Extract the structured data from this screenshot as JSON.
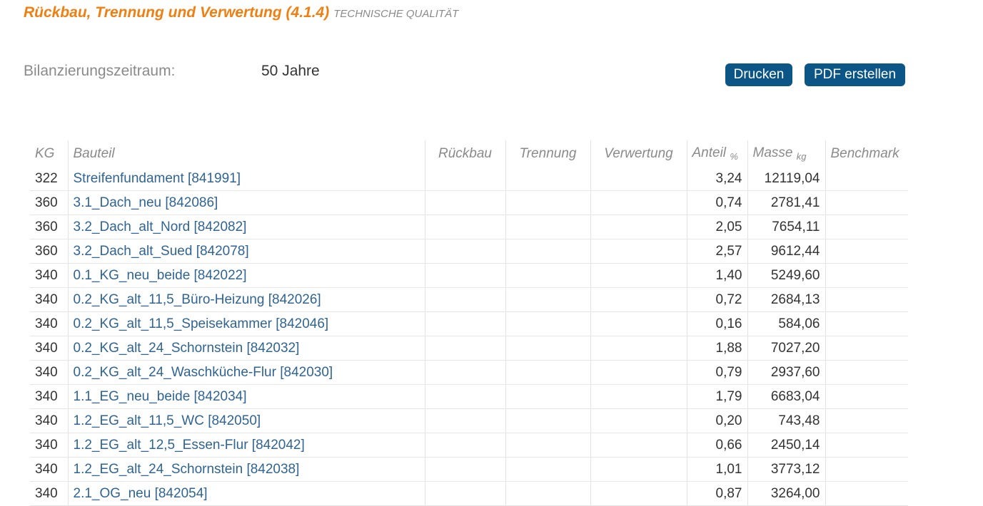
{
  "header": {
    "title": "Rückbau, Trennung und Verwertung (4.1.4)",
    "subtitle": "TECHNISCHE QUALITÄT"
  },
  "period": {
    "label": "Bilanzierungszeitraum:",
    "value": "50 Jahre"
  },
  "actions": {
    "print_label": "Drucken",
    "pdf_label": "PDF erstellen"
  },
  "colors": {
    "title": "#f07f12",
    "button": "#0c5587",
    "link": "#2f6493"
  },
  "table": {
    "headers": {
      "kg": "KG",
      "bauteil": "Bauteil",
      "rueckbau": "Rückbau",
      "trennung": "Trennung",
      "verwertung": "Verwertung",
      "anteil": "Anteil",
      "anteil_unit": "%",
      "masse": "Masse",
      "masse_unit": "kg",
      "benchmark": "Benchmark"
    },
    "rows": [
      {
        "kg": "322",
        "bauteil": "Streifenfundament [841991]",
        "anteil": "3,24",
        "masse": "12119,04"
      },
      {
        "kg": "360",
        "bauteil": "3.1_Dach_neu [842086]",
        "anteil": "0,74",
        "masse": "2781,41"
      },
      {
        "kg": "360",
        "bauteil": "3.2_Dach_alt_Nord [842082]",
        "anteil": "2,05",
        "masse": "7654,11"
      },
      {
        "kg": "360",
        "bauteil": "3.2_Dach_alt_Sued [842078]",
        "anteil": "2,57",
        "masse": "9612,44"
      },
      {
        "kg": "340",
        "bauteil": "0.1_KG_neu_beide [842022]",
        "anteil": "1,40",
        "masse": "5249,60"
      },
      {
        "kg": "340",
        "bauteil": "0.2_KG_alt_11,5_Büro-Heizung [842026]",
        "anteil": "0,72",
        "masse": "2684,13"
      },
      {
        "kg": "340",
        "bauteil": "0.2_KG_alt_11,5_Speisekammer [842046]",
        "anteil": "0,16",
        "masse": "584,06"
      },
      {
        "kg": "340",
        "bauteil": "0.2_KG_alt_24_Schornstein [842032]",
        "anteil": "1,88",
        "masse": "7027,20"
      },
      {
        "kg": "340",
        "bauteil": "0.2_KG_alt_24_Waschküche-Flur [842030]",
        "anteil": "0,79",
        "masse": "2937,60"
      },
      {
        "kg": "340",
        "bauteil": "1.1_EG_neu_beide [842034]",
        "anteil": "1,79",
        "masse": "6683,04"
      },
      {
        "kg": "340",
        "bauteil": "1.2_EG_alt_11,5_WC [842050]",
        "anteil": "0,20",
        "masse": "743,48"
      },
      {
        "kg": "340",
        "bauteil": "1.2_EG_alt_12,5_Essen-Flur [842042]",
        "anteil": "0,66",
        "masse": "2450,14"
      },
      {
        "kg": "340",
        "bauteil": "1.2_EG_alt_24_Schornstein [842038]",
        "anteil": "1,01",
        "masse": "3773,12"
      },
      {
        "kg": "340",
        "bauteil": "2.1_OG_neu [842054]",
        "anteil": "0,87",
        "masse": "3264,00"
      }
    ]
  }
}
